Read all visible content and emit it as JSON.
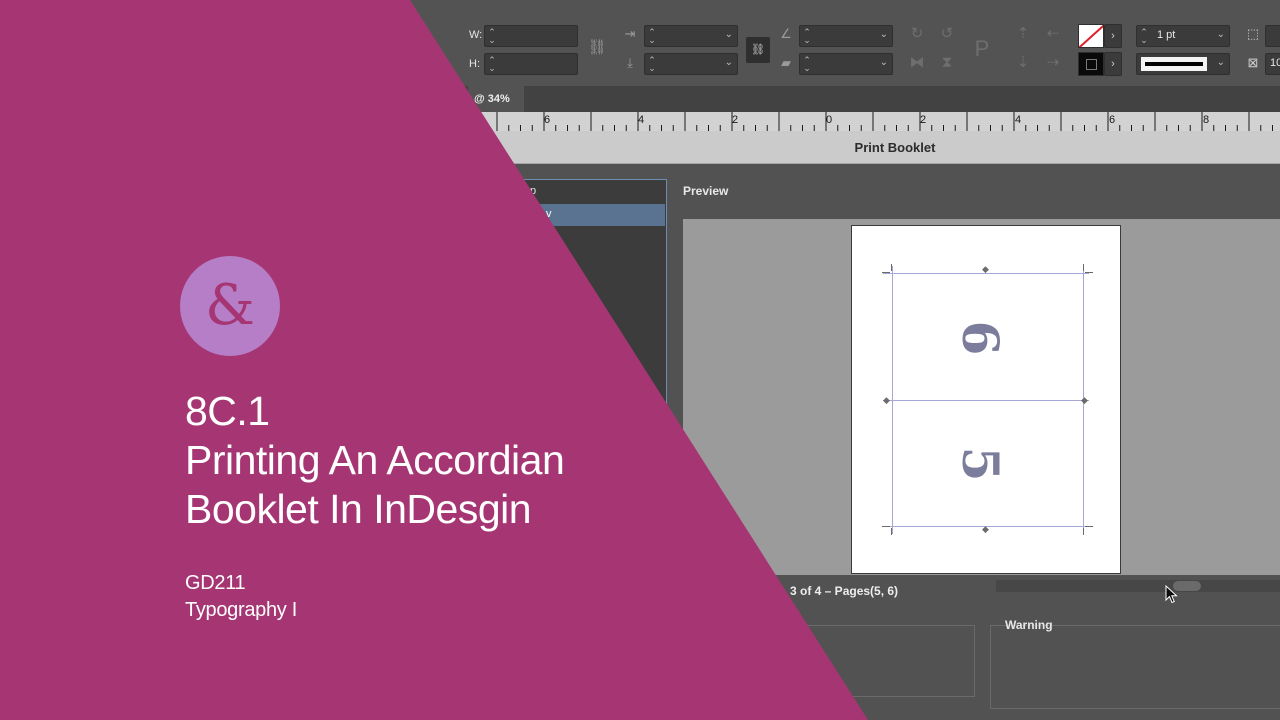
{
  "toolbar": {
    "w_label": "W:",
    "h_label": "H:",
    "stroke_weight": "1 pt",
    "partial_value": "10"
  },
  "document_tab": {
    "label": "@ 34%"
  },
  "ruler": {
    "numbers": [
      "6",
      "4",
      "2",
      "0",
      "2",
      "4",
      "6",
      "8"
    ]
  },
  "dialog": {
    "title": "Print Booklet",
    "preview_label": "Preview",
    "category_partial": [
      "p",
      "v"
    ],
    "page_info": "3 of 4 – Pages(5, 6)",
    "warning_label": "Warning"
  },
  "preview_pages": {
    "top_numeral": "6",
    "bottom_numeral": "5"
  },
  "overlay": {
    "logo_glyph": "&",
    "lesson_number": "8C.1",
    "title_line_1": "Printing An Accordian",
    "title_line_2": "Booklet In InDesgin",
    "course_code": "GD211",
    "course_name": "Typography I",
    "color": "#a63673",
    "logo_color": "#b57ec7"
  }
}
